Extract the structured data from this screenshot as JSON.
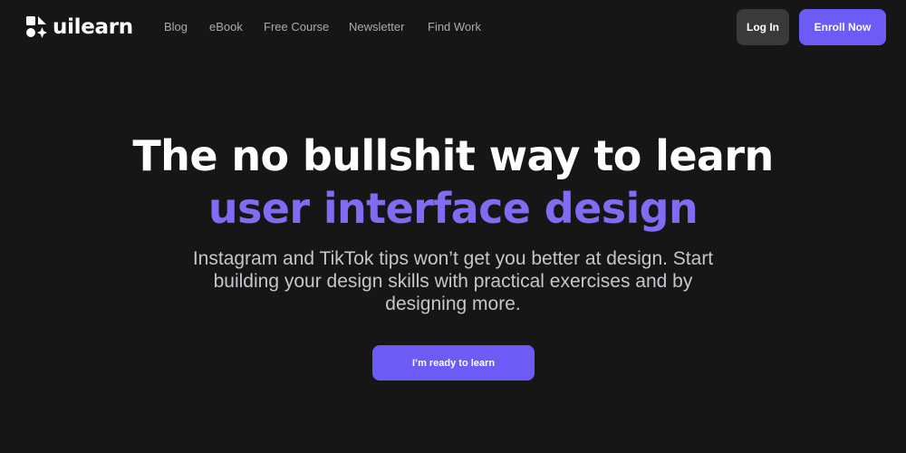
{
  "brand": {
    "name": "uilearn",
    "accent_color": "#6c5bf5",
    "background_color": "#161616"
  },
  "nav": {
    "items": [
      {
        "label": "Blog"
      },
      {
        "label": "eBook"
      },
      {
        "label": "Free Course"
      },
      {
        "label": "Newsletter"
      },
      {
        "label": "Find Work"
      }
    ]
  },
  "header_actions": {
    "login_label": "Log In",
    "enroll_label": "Enroll Now"
  },
  "hero": {
    "title_line1": "The no bullshit way to learn",
    "title_line2": "user interface design",
    "subtitle": "Instagram and TikTok tips won’t get you better at design. Start building your design skills with practical exercises and by designing more.",
    "cta_label": "I’m ready to learn"
  }
}
